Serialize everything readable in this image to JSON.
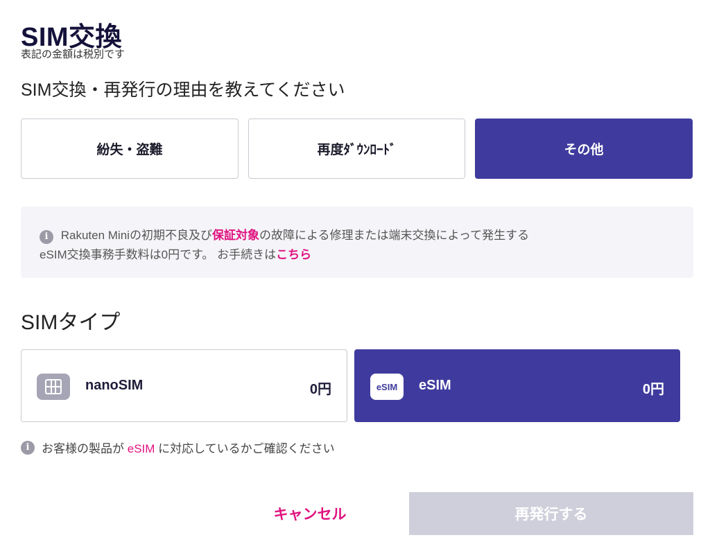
{
  "header": {
    "title": "SIM交換",
    "subtitle": "表記の金額は税別です"
  },
  "reason_section": {
    "heading": "SIM交換・再発行の理由を教えてください",
    "options": [
      {
        "label": "紛失・盗難",
        "selected": false
      },
      {
        "label": "再度ﾀﾞｳﾝﾛｰﾄﾞ",
        "selected": false
      },
      {
        "label": "その他",
        "selected": true
      }
    ]
  },
  "info_box": {
    "icon": "info-icon",
    "line1_part1": "Rakuten Miniの初期不良及び",
    "line1_link": "保証対象",
    "line1_part2": "の故障による修理または端末交換によって発生する",
    "line2_part1": "eSIM交換事務手数料は0円です。 お手続きは",
    "line2_link": "こちら"
  },
  "sim_section": {
    "heading": "SIMタイプ",
    "options": [
      {
        "name": "nanoSIM",
        "price": "0円",
        "icon": "sim-card-icon",
        "selected": false
      },
      {
        "name": "eSIM",
        "price": "0円",
        "icon_label": "eSIM",
        "selected": true
      }
    ]
  },
  "note": {
    "icon": "info-icon",
    "part1": "お客様の製品が",
    "highlight": "eSIM",
    "part2": "に対応しているかご確認ください"
  },
  "actions": {
    "cancel_label": "キャンセル",
    "submit_label": "再発行する",
    "submit_disabled": true
  },
  "colors": {
    "primary": "#3f3b9e",
    "accent_pink": "#e0127f",
    "disabled": "#cfcfdb",
    "info_bg": "#f5f5f9"
  }
}
